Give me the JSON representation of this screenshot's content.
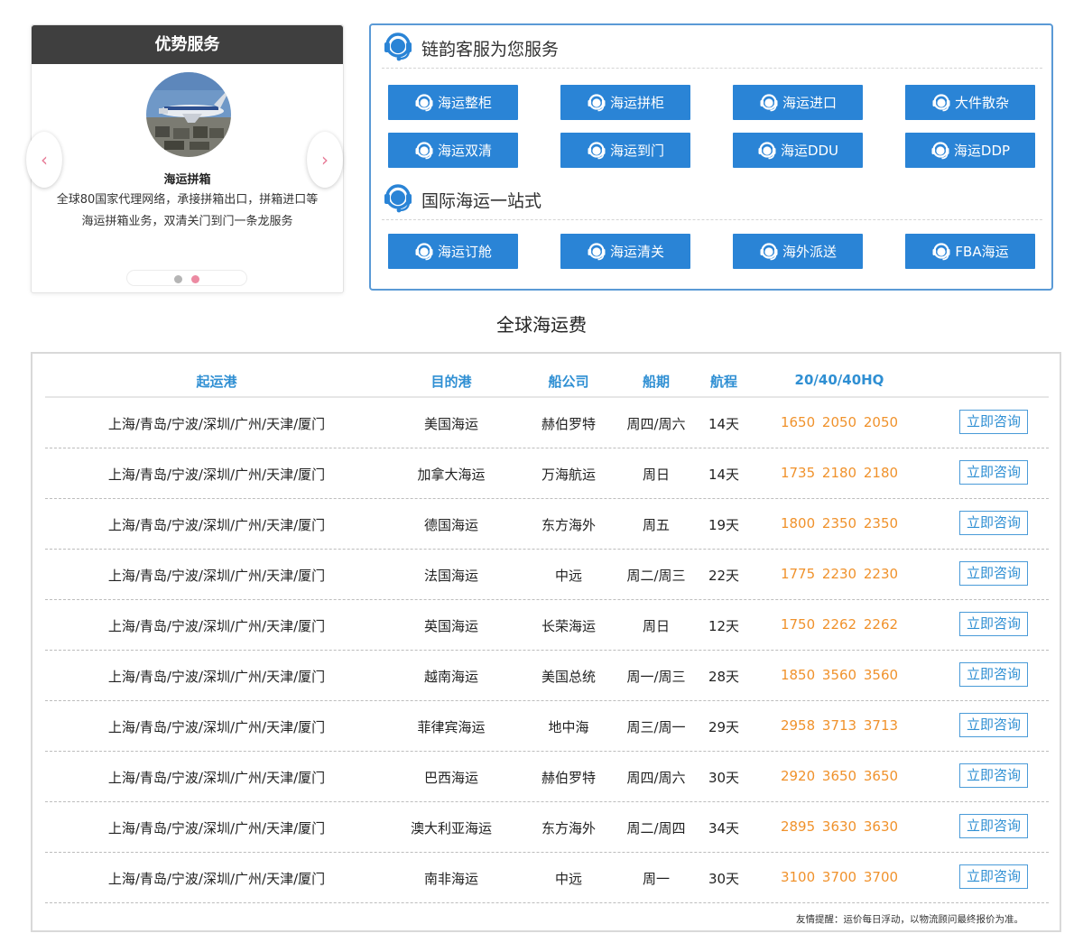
{
  "advantage": {
    "header": "优势服务",
    "slide_title": "海运拼箱",
    "slide_desc_lines": [
      "全球80国家代理网络，承接拼箱出口，拼箱进口等",
      "海运拼箱业务，双清关门到门一条龙服务"
    ],
    "prev_arrow": "‹",
    "next_arrow": "›",
    "active_dot": 2,
    "dot_count": 2
  },
  "services": {
    "heading_1": "链韵客服为您服务",
    "heading_2": "国际海运一站式",
    "buttons_row1": [
      "海运整柜",
      "海运拼柜",
      "海运进口",
      "大件散杂"
    ],
    "buttons_row2": [
      "海运双清",
      "海运到门",
      "海运DDU",
      "海运DDP"
    ],
    "buttons_row3": [
      "海运订舱",
      "海运清关",
      "海外派送",
      "FBA海运"
    ],
    "icon": "headset-icon",
    "accent_color": "#2a84d6"
  },
  "rates": {
    "title": "全球海运费",
    "columns": [
      "起运港",
      "目的港",
      "船公司",
      "船期",
      "航程",
      "20/40/40HQ"
    ],
    "consult_label": "立即咨询",
    "rows": [
      {
        "origin": "上海/青岛/宁波/深圳/广州/天津/厦门",
        "dest": "美国海运",
        "carrier": "赫伯罗特",
        "schedule": "周四/周六",
        "transit": "14天",
        "prices": "1650  2050  2050"
      },
      {
        "origin": "上海/青岛/宁波/深圳/广州/天津/厦门",
        "dest": "加拿大海运",
        "carrier": "万海航运",
        "schedule": "周日",
        "transit": "14天",
        "prices": "1735  2180  2180"
      },
      {
        "origin": "上海/青岛/宁波/深圳/广州/天津/厦门",
        "dest": "德国海运",
        "carrier": "东方海外",
        "schedule": "周五",
        "transit": "19天",
        "prices": "1800  2350  2350"
      },
      {
        "origin": "上海/青岛/宁波/深圳/广州/天津/厦门",
        "dest": "法国海运",
        "carrier": "中远",
        "schedule": "周二/周三",
        "transit": "22天",
        "prices": "1775  2230  2230"
      },
      {
        "origin": "上海/青岛/宁波/深圳/广州/天津/厦门",
        "dest": "英国海运",
        "carrier": "长荣海运",
        "schedule": "周日",
        "transit": "12天",
        "prices": "1750  2262  2262"
      },
      {
        "origin": "上海/青岛/宁波/深圳/广州/天津/厦门",
        "dest": "越南海运",
        "carrier": "美国总统",
        "schedule": "周一/周三",
        "transit": "28天",
        "prices": "1850  3560  3560"
      },
      {
        "origin": "上海/青岛/宁波/深圳/广州/天津/厦门",
        "dest": "菲律宾海运",
        "carrier": "地中海",
        "schedule": "周三/周一",
        "transit": "29天",
        "prices": "2958  3713  3713"
      },
      {
        "origin": "上海/青岛/宁波/深圳/广州/天津/厦门",
        "dest": "巴西海运",
        "carrier": "赫伯罗特",
        "schedule": "周四/周六",
        "transit": "30天",
        "prices": "2920  3650  3650"
      },
      {
        "origin": "上海/青岛/宁波/深圳/广州/天津/厦门",
        "dest": "澳大利亚海运",
        "carrier": "东方海外",
        "schedule": "周二/周四",
        "transit": "34天",
        "prices": "2895  3630  3630"
      },
      {
        "origin": "上海/青岛/宁波/深圳/广州/天津/厦门",
        "dest": "南非海运",
        "carrier": "中远",
        "schedule": "周一",
        "transit": "30天",
        "prices": "3100  3700  3700"
      }
    ],
    "tip": "友情提醒：运价每日浮动，以物流顾问最终报价为准。",
    "price_color": "#f0922c",
    "header_color": "#2f8fd3"
  }
}
